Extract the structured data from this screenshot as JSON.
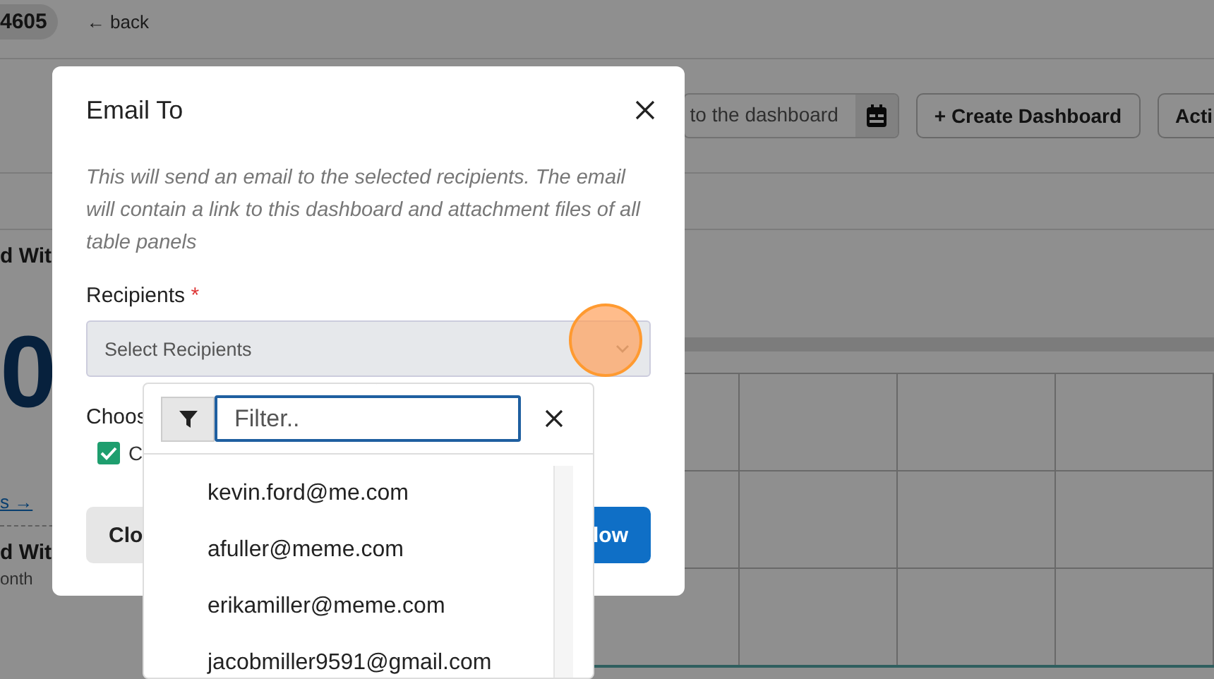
{
  "page": {
    "badge": "4605",
    "back_link": "← back",
    "date_field": {
      "value": "to the dashboard"
    },
    "buttons": [
      {
        "label": "+ Create Dashboard"
      },
      {
        "label": "Acti"
      }
    ],
    "panels": [
      {
        "title": "d Wit",
        "value": "0",
        "link": "s →"
      },
      {
        "title": "d Wit",
        "subtitle": "onth"
      }
    ]
  },
  "modal": {
    "title": "Email To",
    "description": "This will send an email to the selected recipients. The email will contain a link to this dashboard and attachment files of all table panels",
    "recipients": {
      "label": "Recipients",
      "required_mark": "*",
      "placeholder": "Select Recipients"
    },
    "choose_label": "Choos",
    "checkbox": {
      "label": "C",
      "checked": true
    },
    "buttons": [
      {
        "label": "Clo",
        "kind": "secondary"
      },
      {
        "label": "low",
        "kind": "primary"
      }
    ]
  },
  "dropdown": {
    "filter_placeholder": "Filter..",
    "options": [
      "kevin.ford@me.com",
      "afuller@meme.com",
      "erikamiller@meme.com",
      "jacobmiller9591@gmail.com"
    ]
  }
}
